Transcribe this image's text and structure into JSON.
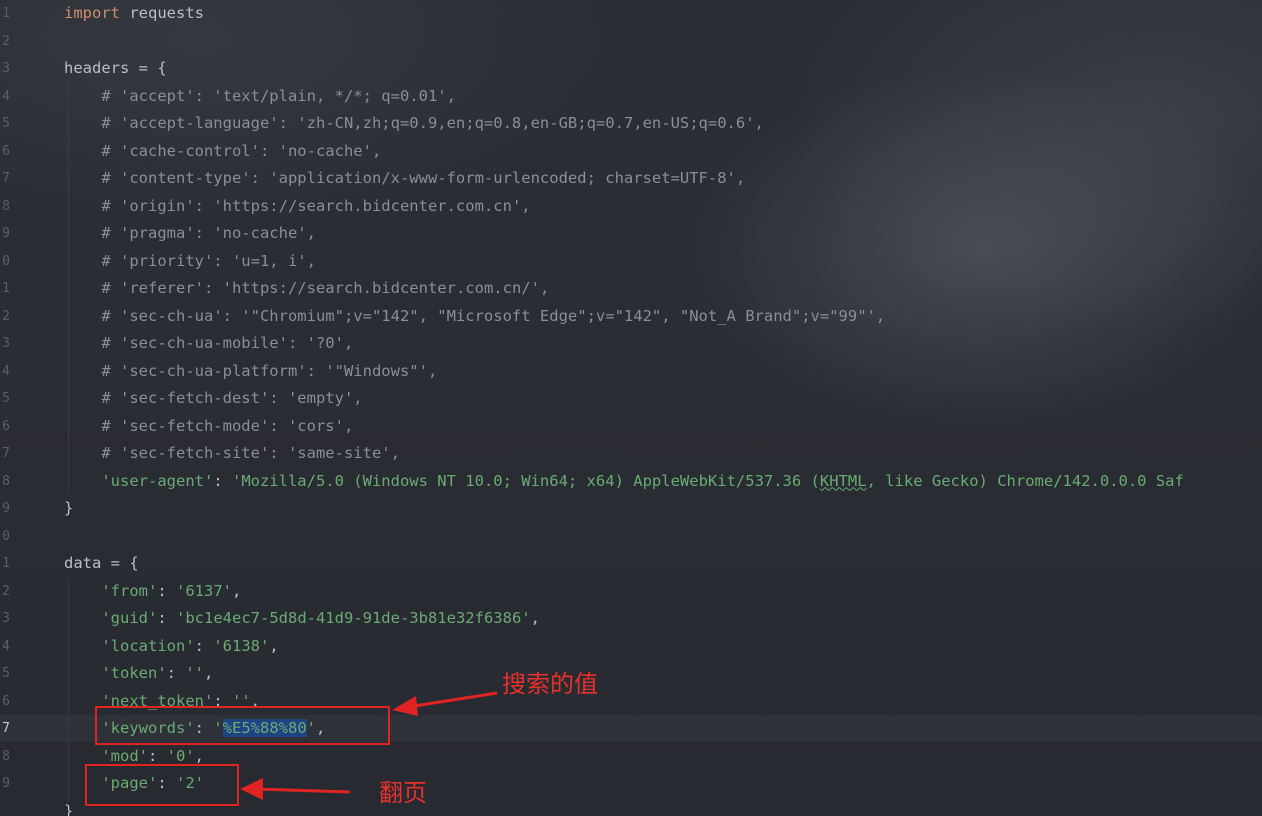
{
  "lines": [
    {
      "num": "1",
      "parts": [
        {
          "t": "import",
          "c": "kw"
        },
        {
          "t": " requests",
          "c": "fn"
        }
      ]
    },
    {
      "num": "2",
      "parts": []
    },
    {
      "num": "3",
      "parts": [
        {
          "t": "headers = {",
          "c": "fn"
        }
      ]
    },
    {
      "num": "4",
      "parts": [
        {
          "t": "    # 'accept': 'text/plain, */*; q=0.01',",
          "c": "cm"
        }
      ]
    },
    {
      "num": "5",
      "parts": [
        {
          "t": "    # 'accept-language': 'zh-CN,zh;q=0.9,en;q=0.8,en-GB;q=0.7,en-US;q=0.6',",
          "c": "cm"
        }
      ]
    },
    {
      "num": "6",
      "parts": [
        {
          "t": "    # 'cache-control': 'no-cache',",
          "c": "cm"
        }
      ]
    },
    {
      "num": "7",
      "parts": [
        {
          "t": "    # 'content-type': 'application/x-www-form-urlencoded; charset=UTF-8',",
          "c": "cm"
        }
      ]
    },
    {
      "num": "8",
      "parts": [
        {
          "t": "    # 'origin': '",
          "c": "cm"
        },
        {
          "t": "https://search.bidcenter.com.cn",
          "c": "cm lnk"
        },
        {
          "t": "',",
          "c": "cm"
        }
      ]
    },
    {
      "num": "9",
      "parts": [
        {
          "t": "    # 'pragma': 'no-cache',",
          "c": "cm"
        }
      ]
    },
    {
      "num": "0",
      "parts": [
        {
          "t": "    # 'priority': 'u=1, i',",
          "c": "cm"
        }
      ]
    },
    {
      "num": "1",
      "parts": [
        {
          "t": "    # 'referer': '",
          "c": "cm"
        },
        {
          "t": "https://search.bidcenter.com.cn/",
          "c": "cm lnk"
        },
        {
          "t": "',",
          "c": "cm"
        }
      ]
    },
    {
      "num": "2",
      "parts": [
        {
          "t": "    # 'sec-ch-ua': '\"Chromium\";v=\"142\", \"Microsoft Edge\";v=\"142\", \"Not_A Brand\";v=\"99\"',",
          "c": "cm"
        }
      ]
    },
    {
      "num": "3",
      "parts": [
        {
          "t": "    # 'sec-ch-ua-mobile': '?0',",
          "c": "cm"
        }
      ]
    },
    {
      "num": "4",
      "parts": [
        {
          "t": "    # 'sec-ch-ua-platform': '\"Windows\"',",
          "c": "cm"
        }
      ]
    },
    {
      "num": "5",
      "parts": [
        {
          "t": "    # 'sec-fetch-dest': 'empty',",
          "c": "cm"
        }
      ]
    },
    {
      "num": "6",
      "parts": [
        {
          "t": "    # 'sec-fetch-mode': 'cors',",
          "c": "cm"
        }
      ]
    },
    {
      "num": "7",
      "parts": [
        {
          "t": "    # 'sec-fetch-site': 'same-site',",
          "c": "cm"
        }
      ]
    },
    {
      "num": "8",
      "parts": [
        {
          "t": "    'user-agent'",
          "c": "key"
        },
        {
          "t": ": ",
          "c": "fn"
        },
        {
          "t": "'Mozilla/5.0 (Windows NT 10.0; Win64; x64) AppleWebKit/537.36 (",
          "c": "str"
        },
        {
          "t": "KHTML",
          "c": "str wavy"
        },
        {
          "t": ", like Gecko) Chrome/142.0.0.0 Saf",
          "c": "str"
        }
      ]
    },
    {
      "num": "9",
      "parts": [
        {
          "t": "}",
          "c": "fn"
        }
      ]
    },
    {
      "num": "0",
      "parts": []
    },
    {
      "num": "1",
      "parts": [
        {
          "t": "data = {",
          "c": "fn"
        }
      ]
    },
    {
      "num": "2",
      "parts": [
        {
          "t": "    'from'",
          "c": "key"
        },
        {
          "t": ": ",
          "c": "fn"
        },
        {
          "t": "'6137'",
          "c": "str"
        },
        {
          "t": ",",
          "c": "fn"
        }
      ]
    },
    {
      "num": "3",
      "parts": [
        {
          "t": "    'guid'",
          "c": "key"
        },
        {
          "t": ": ",
          "c": "fn"
        },
        {
          "t": "'bc1e4ec7-5d8d-41d9-91de-3b81e32f6386'",
          "c": "str"
        },
        {
          "t": ",",
          "c": "fn"
        }
      ]
    },
    {
      "num": "4",
      "parts": [
        {
          "t": "    'location'",
          "c": "key"
        },
        {
          "t": ": ",
          "c": "fn"
        },
        {
          "t": "'6138'",
          "c": "str"
        },
        {
          "t": ",",
          "c": "fn"
        }
      ]
    },
    {
      "num": "5",
      "parts": [
        {
          "t": "    'token'",
          "c": "key"
        },
        {
          "t": ": ",
          "c": "fn"
        },
        {
          "t": "''",
          "c": "str"
        },
        {
          "t": ",",
          "c": "fn"
        }
      ]
    },
    {
      "num": "6",
      "parts": [
        {
          "t": "    'next_token'",
          "c": "key"
        },
        {
          "t": ": ",
          "c": "fn"
        },
        {
          "t": "''",
          "c": "str"
        },
        {
          "t": ",",
          "c": "fn"
        }
      ]
    },
    {
      "num": "7",
      "current": true,
      "parts": [
        {
          "t": "    'keywords'",
          "c": "key"
        },
        {
          "t": ": ",
          "c": "fn"
        },
        {
          "t": "'",
          "c": "str"
        },
        {
          "t": "%E5%88%80",
          "c": "sel"
        },
        {
          "t": "'",
          "c": "str"
        },
        {
          "t": ",",
          "c": "fn"
        }
      ]
    },
    {
      "num": "8",
      "parts": [
        {
          "t": "    'mod'",
          "c": "key"
        },
        {
          "t": ": ",
          "c": "fn"
        },
        {
          "t": "'0'",
          "c": "str"
        },
        {
          "t": ",",
          "c": "fn"
        }
      ]
    },
    {
      "num": "9",
      "parts": [
        {
          "t": "    'page'",
          "c": "key"
        },
        {
          "t": ": ",
          "c": "fn"
        },
        {
          "t": "'2'",
          "c": "str"
        }
      ]
    },
    {
      "num": "",
      "parts": [
        {
          "t": "}",
          "c": "fn"
        }
      ]
    }
  ],
  "annotations": {
    "search_value_label": "搜索的值",
    "page_label": "翻页"
  },
  "colors": {
    "keyword": "#cf8e6d",
    "string": "#6aab73",
    "comment": "#8b8e94",
    "annotation": "#e02424",
    "selection": "#214283"
  }
}
